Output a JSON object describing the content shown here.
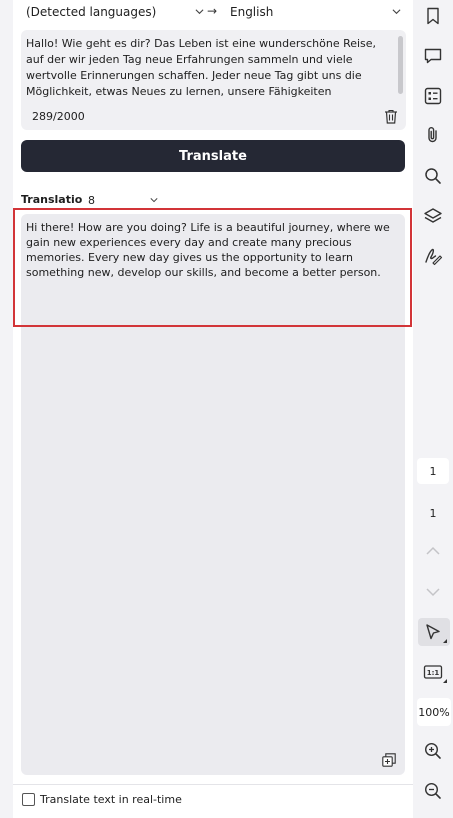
{
  "languages": {
    "source": "(Detected languages)",
    "arrow": "→",
    "target": "English"
  },
  "source": {
    "text": "Hallo! Wie geht es dir? Das Leben ist eine wunderschöne Reise, auf der wir jeden Tag neue Erfahrungen sammeln und viele wertvolle Erinnerungen schaffen. Jeder neue Tag gibt uns die Möglichkeit, etwas Neues zu lernen, unsere Fähigkeiten weiterzuentwickeln und wir bessere Menschen werden.",
    "char_count": "289/2000"
  },
  "translate_button": "Translate",
  "translation": {
    "label": "Translation",
    "engine_value": "8",
    "text": "Hi there! How are you doing? Life is a beautiful journey, where we gain new experiences every day and create many precious memories. Every new day gives us the opportunity to learn something new, develop our skills, and become a better person."
  },
  "footer": {
    "realtime_label": "Translate text in real-time"
  },
  "toolbar": {
    "current_page": "1",
    "total_pages": "1",
    "zoom": "100%",
    "icons": [
      "bookmark-icon",
      "comment-icon",
      "form-icon",
      "attachment-icon",
      "search-icon",
      "layers-icon",
      "signature-icon"
    ]
  }
}
